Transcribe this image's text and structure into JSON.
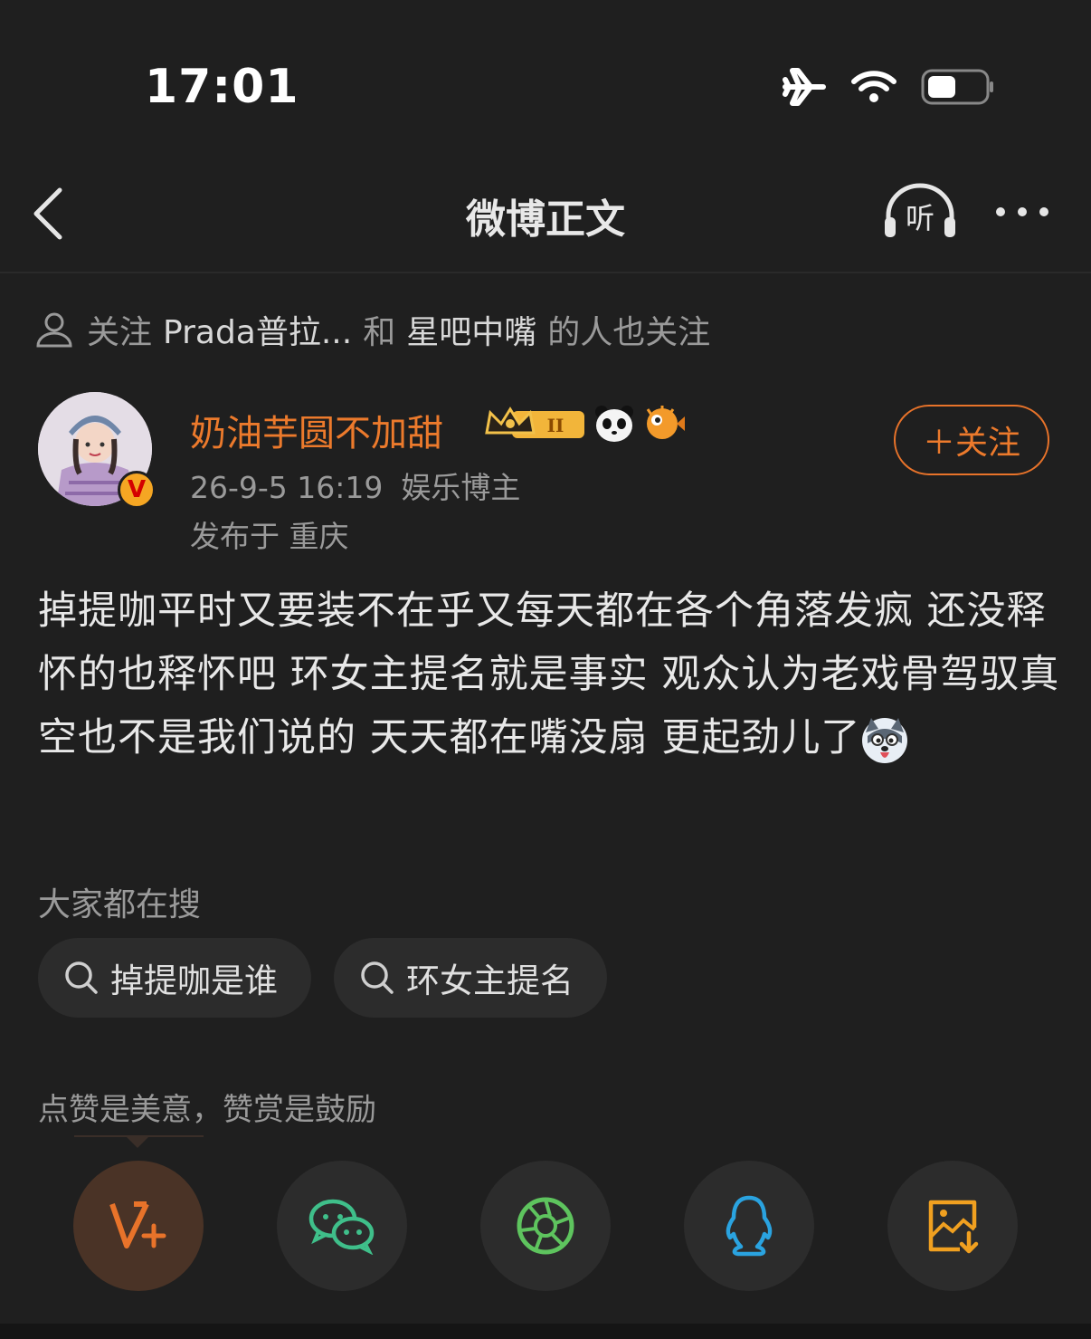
{
  "status_bar": {
    "time": "17:01",
    "icons": [
      "airplane-icon",
      "wifi-icon",
      "battery-icon"
    ]
  },
  "nav": {
    "title": "微博正文",
    "listen_label": "听"
  },
  "follow_hint": {
    "prefix": "关注",
    "user1": "Prada普拉...",
    "and": "和",
    "user2": "星吧中嘴",
    "suffix": "的人也关注"
  },
  "author": {
    "name": "奶油芋圆不加甜",
    "verified_badge": "V",
    "level_badge": "II",
    "date": "26-9-5 16:19",
    "role": "娱乐博主",
    "location": "发布于 重庆",
    "follow_label": "＋关注"
  },
  "post": {
    "text": "掉提咖平时又要装不在乎又每天都在各个角落发疯 还没释怀的也释怀吧 环女主提名就是事实 观众认为老戏骨驾驭真空也不是我们说的 天天都在嘴没扇 更起劲儿了"
  },
  "search": {
    "heading": "大家都在搜",
    "chips": [
      "掉提咖是谁",
      "环女主提名"
    ]
  },
  "reward": {
    "text": "点赞是美意，赞赏是鼓励"
  },
  "share": [
    {
      "name": "v-plus",
      "color": "#e8732a"
    },
    {
      "name": "wechat",
      "color": "#3fbf8a"
    },
    {
      "name": "moments",
      "color": "#5ec45e"
    },
    {
      "name": "qq",
      "color": "#2aa3e0"
    },
    {
      "name": "save-image",
      "color": "#f0a020"
    }
  ],
  "colors": {
    "accent": "#ec7a2c",
    "background": "#1f1f1f"
  }
}
